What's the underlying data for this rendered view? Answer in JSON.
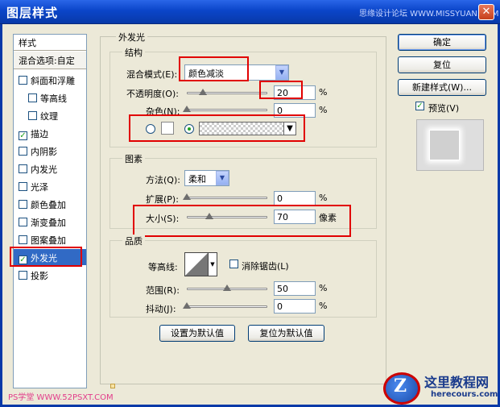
{
  "window": {
    "title": "图层样式",
    "watermark": "思缘设计论坛 WWW.MISSYUAN.COM",
    "close_label": "✕"
  },
  "left": {
    "header": "样式",
    "blend_options": "混合选项:自定",
    "items": [
      {
        "label": "斜面和浮雕",
        "checked": false,
        "indent": false
      },
      {
        "label": "等高线",
        "checked": false,
        "indent": true
      },
      {
        "label": "纹理",
        "checked": false,
        "indent": true
      },
      {
        "label": "描边",
        "checked": true,
        "indent": false
      },
      {
        "label": "内阴影",
        "checked": false,
        "indent": false
      },
      {
        "label": "内发光",
        "checked": false,
        "indent": false
      },
      {
        "label": "光泽",
        "checked": false,
        "indent": false
      },
      {
        "label": "颜色叠加",
        "checked": false,
        "indent": false
      },
      {
        "label": "渐变叠加",
        "checked": false,
        "indent": false
      },
      {
        "label": "图案叠加",
        "checked": false,
        "indent": false
      },
      {
        "label": "外发光",
        "checked": true,
        "indent": false
      },
      {
        "label": "投影",
        "checked": false,
        "indent": false
      }
    ],
    "check_mark": "✓"
  },
  "outer_glow": {
    "title": "外发光",
    "structure": {
      "title": "结构",
      "blend_mode_label": "混合模式(E):",
      "blend_mode_value": "颜色减淡",
      "opacity_label": "不透明度(O):",
      "opacity_value": "20",
      "opacity_fraction": 0.2,
      "noise_label": "杂色(N):",
      "noise_value": "0",
      "noise_fraction": 0,
      "percent": "%"
    },
    "elements": {
      "title": "图素",
      "technique_label": "方法(Q):",
      "technique_value": "柔和",
      "spread_label": "扩展(P):",
      "spread_value": "0",
      "spread_fraction": 0,
      "size_label": "大小(S):",
      "size_value": "70",
      "size_fraction": 0.28,
      "size_unit": "像素",
      "percent": "%"
    },
    "quality": {
      "title": "品质",
      "contour_label": "等高线:",
      "antialias_label": "消除锯齿(L)",
      "range_label": "范围(R):",
      "range_value": "50",
      "range_fraction": 0.5,
      "jitter_label": "抖动(J):",
      "jitter_value": "0",
      "jitter_fraction": 0,
      "percent": "%"
    },
    "make_default": "设置为默认值",
    "reset_default": "复位为默认值"
  },
  "buttons": {
    "ok": "确定",
    "reset": "复位",
    "new_style": "新建样式(W)...",
    "preview_label": "预览(V)",
    "preview_checked": true
  },
  "footer": {
    "watermark_left": "PS学堂 WWW.52PSXT.COM",
    "logo_letter": "Z",
    "logo_name": "这里教程网",
    "logo_url": "herecours.com"
  },
  "colors": {
    "highlight": "#e10000",
    "selection": "#316ac5",
    "titlebar": "#0b45c9"
  }
}
